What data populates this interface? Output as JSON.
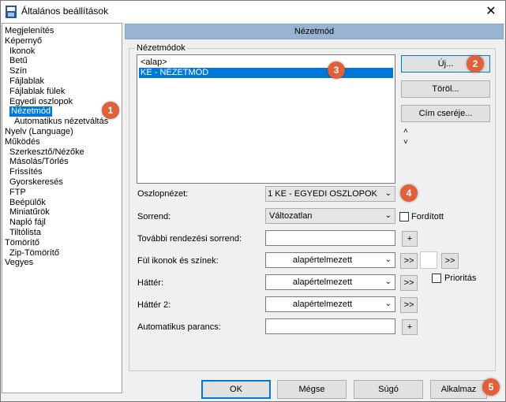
{
  "window": {
    "title": "Általános beállítások",
    "close": "✕"
  },
  "tree": {
    "items": [
      {
        "label": "Megjelenítés"
      },
      {
        "label": "Képernyő"
      },
      {
        "label": "Ikonok"
      },
      {
        "label": "Betű"
      },
      {
        "label": "Szín"
      },
      {
        "label": "Fájlablak"
      },
      {
        "label": "Fájlablak fülek"
      },
      {
        "label": "Egyedi oszlopok"
      },
      {
        "label": "Nézetmód",
        "selected": true
      },
      {
        "label": "Automatikus nézetváltás"
      },
      {
        "label": "Nyelv (Language)"
      },
      {
        "label": "Működés"
      },
      {
        "label": "Szerkesztő/Nézőke"
      },
      {
        "label": "Másolás/Törlés"
      },
      {
        "label": "Frissítés"
      },
      {
        "label": "Gyorskeresés"
      },
      {
        "label": "FTP"
      },
      {
        "label": "Beépülők"
      },
      {
        "label": "Miniatűrök"
      },
      {
        "label": "Napló fájl"
      },
      {
        "label": "Tiltólista"
      },
      {
        "label": "Tömörítő"
      },
      {
        "label": "Zip-Tömörítő"
      },
      {
        "label": "Vegyes"
      }
    ]
  },
  "panel": {
    "header": "Nézetmód",
    "group_label": "Nézetmódok"
  },
  "list": {
    "items": [
      {
        "label": "<alap>"
      },
      {
        "label": "KE - NÉZETMÓD",
        "selected": true
      }
    ]
  },
  "buttons": {
    "new": "Új...",
    "delete": "Töröl...",
    "rename": "Cím cseréje..."
  },
  "arrows": {
    "up": "˄",
    "down": "˅"
  },
  "fields": {
    "columns": {
      "label": "Oszlopnézet:",
      "value": "1 KE - EGYEDI OSZLOPOK"
    },
    "order": {
      "label": "Sorrend:",
      "value": "Változatlan",
      "reverse_label": "Fordított"
    },
    "extra_order": {
      "label": "További rendezési sorrend:",
      "value": "",
      "add": "+"
    },
    "tab_icons": {
      "label": "Fül ikonok és színek:",
      "value": "alapértelmezett",
      "more": ">>",
      "more2": ">>"
    },
    "background": {
      "label": "Háttér:",
      "value": "alapértelmezett",
      "more": ">>",
      "priority_label": "Prioritás"
    },
    "background2": {
      "label": "Háttér 2:",
      "value": "alapértelmezett",
      "more": ">>"
    },
    "auto_cmd": {
      "label": "Automatikus parancs:",
      "value": "",
      "add": "+"
    }
  },
  "footer": {
    "ok": "OK",
    "cancel": "Mégse",
    "help": "Súgó",
    "apply": "Alkalmaz"
  },
  "badges": {
    "b1": "1",
    "b2": "2",
    "b3": "3",
    "b4": "4",
    "b5": "5"
  },
  "colors": {
    "selection": "#0078d7",
    "header": "#99b4d1",
    "badge": "#e0603a"
  }
}
